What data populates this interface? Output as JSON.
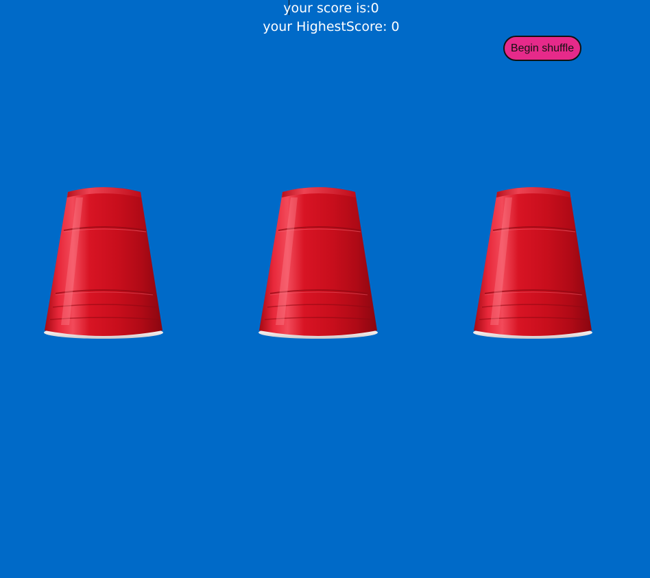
{
  "game": {
    "score_label": "your score is:",
    "score": "0",
    "highscore_label": "your HighestScore: ",
    "highscore": "0"
  },
  "controls": {
    "shuffle_label": "Begin shuffle"
  },
  "cups": [
    {
      "icon": "red-cup-icon"
    },
    {
      "icon": "red-cup-icon"
    },
    {
      "icon": "red-cup-icon"
    }
  ],
  "colors": {
    "background": "#006ac8",
    "button": "#e62a8a",
    "cup": "#d4101e",
    "text": "#ffffff"
  }
}
